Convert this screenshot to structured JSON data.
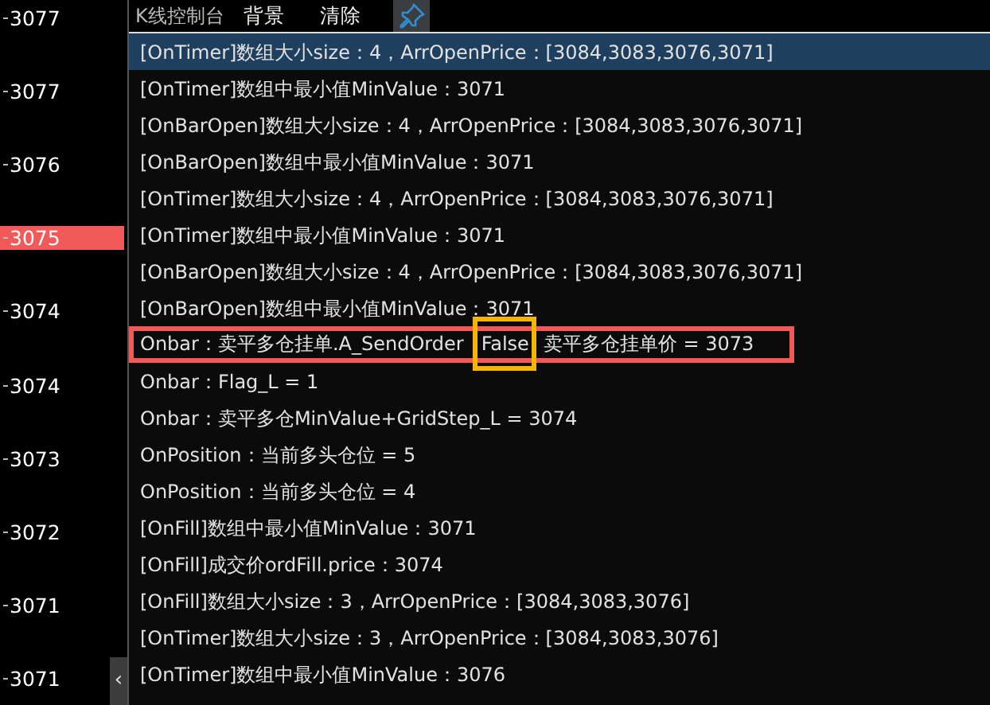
{
  "price_axis": {
    "labels": [
      {
        "text": "3077",
        "current": false
      },
      {
        "text": "3077",
        "current": false
      },
      {
        "text": "3076",
        "current": false
      },
      {
        "text": "3075",
        "current": true
      },
      {
        "text": "3074",
        "current": false
      },
      {
        "text": "3074",
        "current": false
      },
      {
        "text": "3073",
        "current": false
      },
      {
        "text": "3072",
        "current": false
      },
      {
        "text": "3071",
        "current": false
      },
      {
        "text": "3071",
        "current": false
      }
    ],
    "collapse_glyph": "‹"
  },
  "console": {
    "title": "K线控制台",
    "menu": [
      "背景",
      "清除"
    ],
    "pinned": true,
    "rows": [
      {
        "text": "[OnTimer]数组大小size：4，ArrOpenPrice：[3084,3083,3076,3071]",
        "selected": true,
        "outlined": false
      },
      {
        "text": "[OnTimer]数组中最小值MinValue：3071",
        "selected": false,
        "outlined": false
      },
      {
        "text": "[OnBarOpen]数组大小size：4，ArrOpenPrice：[3084,3083,3076,3071]",
        "selected": false,
        "outlined": false
      },
      {
        "text": "[OnBarOpen]数组中最小值MinValue：3071",
        "selected": false,
        "outlined": false
      },
      {
        "text": "[OnTimer]数组大小size：4，ArrOpenPrice：[3084,3083,3076,3071]",
        "selected": false,
        "outlined": false
      },
      {
        "text": "[OnTimer]数组中最小值MinValue：3071",
        "selected": false,
        "outlined": false
      },
      {
        "text": "[OnBarOpen]数组大小size：4，ArrOpenPrice：[3084,3083,3076,3071]",
        "selected": false,
        "outlined": false
      },
      {
        "text": "[OnBarOpen]数组中最小值MinValue：3071",
        "selected": false,
        "outlined": false
      },
      {
        "segments": [
          {
            "text": "Onbar：卖平多仓挂单.A_SendOrder",
            "boxed": false
          },
          {
            "text": "False",
            "boxed": true
          },
          {
            "text": "卖平多仓挂单价 = 3073",
            "boxed": false
          }
        ],
        "selected": false,
        "outlined": true
      },
      {
        "text": "Onbar：Flag_L = 1",
        "selected": false,
        "outlined": false
      },
      {
        "text": "Onbar：卖平多仓MinValue+GridStep_L = 3074",
        "selected": false,
        "outlined": false
      },
      {
        "text": "OnPosition：当前多头仓位 = 5",
        "selected": false,
        "outlined": false
      },
      {
        "text": "OnPosition：当前多头仓位 = 4",
        "selected": false,
        "outlined": false
      },
      {
        "text": "[OnFill]数组中最小值MinValue：3071",
        "selected": false,
        "outlined": false
      },
      {
        "text": "[OnFill]成交价ordFill.price：3074",
        "selected": false,
        "outlined": false
      },
      {
        "text": "[OnFill]数组大小size：3，ArrOpenPrice：[3084,3083,3076]",
        "selected": false,
        "outlined": false
      },
      {
        "text": "[OnTimer]数组大小size：3，ArrOpenPrice：[3084,3083,3076]",
        "selected": false,
        "outlined": false
      },
      {
        "text": "[OnTimer]数组中最小值MinValue：3076",
        "selected": false,
        "outlined": false
      }
    ]
  }
}
